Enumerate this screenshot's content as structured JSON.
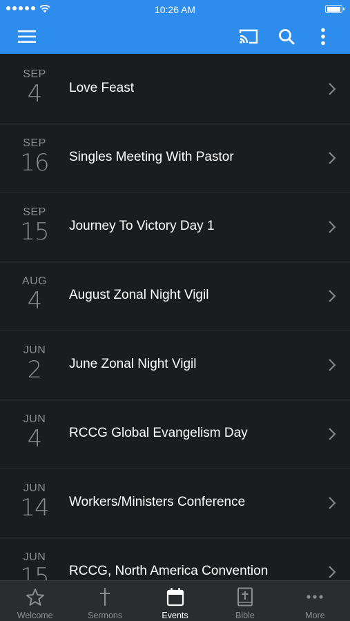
{
  "status_bar": {
    "time": "10:26 AM"
  },
  "events": [
    {
      "month": "SEP",
      "day": "4",
      "title": "Love Feast"
    },
    {
      "month": "SEP",
      "day": "16",
      "title": "Singles Meeting With Pastor"
    },
    {
      "month": "SEP",
      "day": "15",
      "title": "Journey To Victory Day 1"
    },
    {
      "month": "AUG",
      "day": "4",
      "title": "August Zonal Night Vigil"
    },
    {
      "month": "JUN",
      "day": "2",
      "title": "June Zonal Night Vigil"
    },
    {
      "month": "JUN",
      "day": "4",
      "title": "RCCG Global Evangelism Day"
    },
    {
      "month": "JUN",
      "day": "14",
      "title": "Workers/Ministers Conference"
    },
    {
      "month": "JUN",
      "day": "15",
      "title": "RCCG, North America Convention"
    }
  ],
  "tabs": [
    {
      "label": "Welcome",
      "icon": "star-icon"
    },
    {
      "label": "Sermons",
      "icon": "cross-icon"
    },
    {
      "label": "Events",
      "icon": "calendar-icon",
      "active": true
    },
    {
      "label": "Bible",
      "icon": "bible-icon"
    },
    {
      "label": "More",
      "icon": "ellipsis-icon"
    }
  ],
  "colors": {
    "accent": "#2d8cec",
    "background": "#1b1c1e",
    "tab_bar": "#2b2c2f"
  }
}
